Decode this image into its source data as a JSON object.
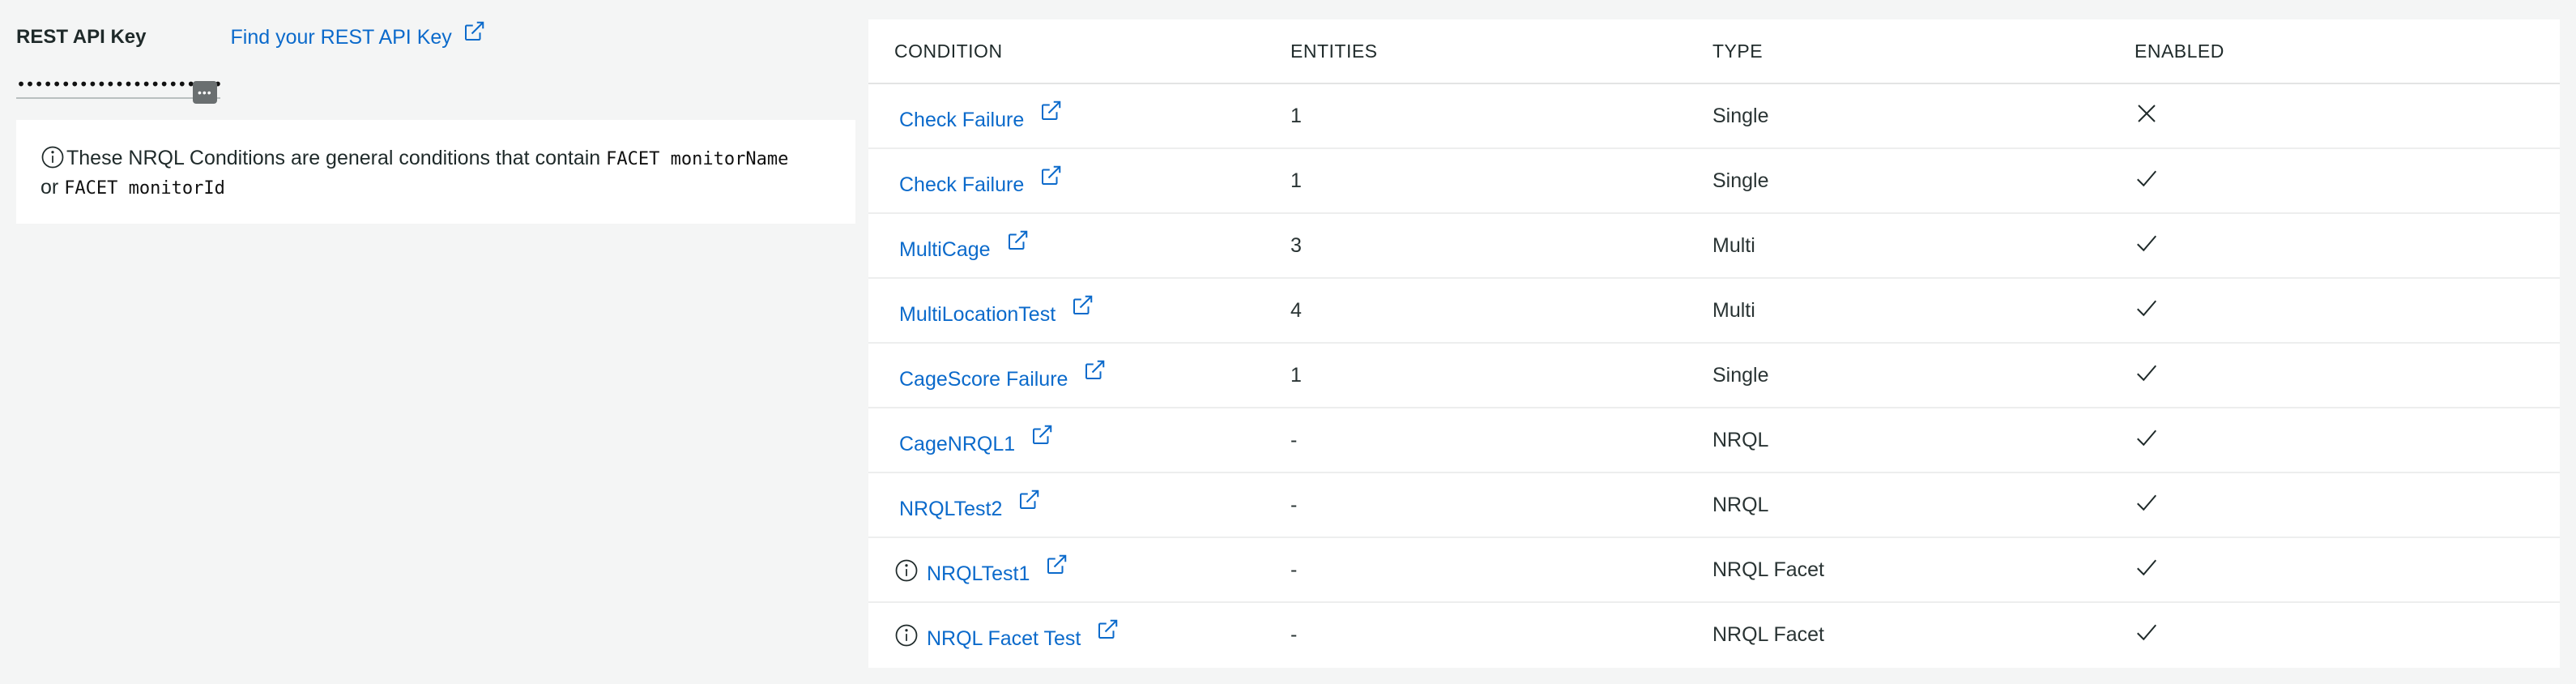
{
  "api_key": {
    "label": "REST API Key",
    "link_text": "Find your REST API Key",
    "masked_value": "••••••••••••••••••••••••••••••••",
    "toggle_glyph": "•••"
  },
  "info_box": {
    "text_before": "These NRQL Conditions are general conditions that contain ",
    "code1": "FACET monitorName",
    "text_middle": " or ",
    "code2": "FACET monitorId"
  },
  "table": {
    "headers": {
      "condition": "CONDITION",
      "entities": "ENTITIES",
      "type": "TYPE",
      "enabled": "ENABLED"
    },
    "rows": [
      {
        "condition": "Check Failure",
        "entities": "1",
        "type": "Single",
        "enabled": false,
        "info": false
      },
      {
        "condition": "Check Failure",
        "entities": "1",
        "type": "Single",
        "enabled": true,
        "info": false
      },
      {
        "condition": "MultiCage",
        "entities": "3",
        "type": "Multi",
        "enabled": true,
        "info": false
      },
      {
        "condition": "MultiLocationTest",
        "entities": "4",
        "type": "Multi",
        "enabled": true,
        "info": false
      },
      {
        "condition": "CageScore Failure",
        "entities": "1",
        "type": "Single",
        "enabled": true,
        "info": false
      },
      {
        "condition": "CageNRQL1",
        "entities": "-",
        "type": "NRQL",
        "enabled": true,
        "info": false
      },
      {
        "condition": "NRQLTest2",
        "entities": "-",
        "type": "NRQL",
        "enabled": true,
        "info": false
      },
      {
        "condition": "NRQLTest1",
        "entities": "-",
        "type": "NRQL Facet",
        "enabled": true,
        "info": true
      },
      {
        "condition": "NRQL Facet Test",
        "entities": "-",
        "type": "NRQL Facet",
        "enabled": true,
        "info": true
      }
    ]
  },
  "colors": {
    "link": "#0b6acb",
    "text": "#2a3434",
    "background": "#f4f5f5"
  },
  "icons": {
    "external_link": "external-link-icon",
    "info": "info-icon",
    "check": "check-icon",
    "close": "close-icon"
  }
}
